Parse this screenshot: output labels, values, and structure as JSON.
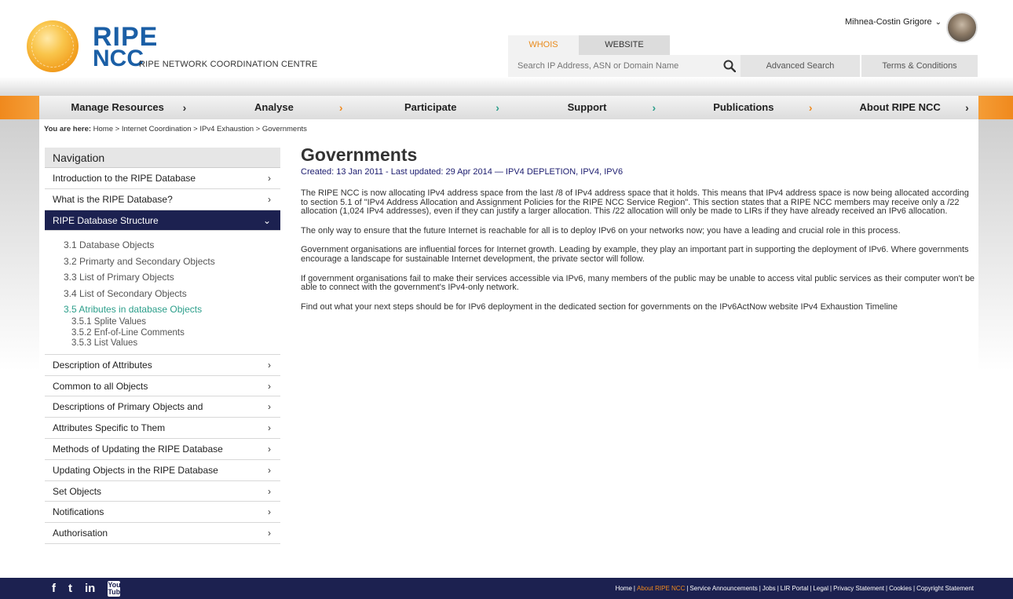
{
  "header": {
    "logo_ripe": "RIPE",
    "logo_ncc": "NCC",
    "logo_sub": "RIPE NETWORK COORDINATION CENTRE",
    "user_name": "Mihnea-Costin Grigore",
    "tabs": [
      {
        "label": "WHOIS"
      },
      {
        "label": "WEBSITE"
      }
    ],
    "search_placeholder": "Search IP Address, ASN or Domain Name",
    "advanced_search": "Advanced Search",
    "terms": "Terms & Conditions"
  },
  "nav": {
    "items": [
      {
        "label": "Manage Resources",
        "chevron_color": "#333333"
      },
      {
        "label": "Analyse",
        "chevron_color": "#f0891d"
      },
      {
        "label": "Participate",
        "chevron_color": "#2b9e8a"
      },
      {
        "label": "Support",
        "chevron_color": "#2b9e8a"
      },
      {
        "label": "Publications",
        "chevron_color": "#f0891d"
      },
      {
        "label": "About RIPE NCC",
        "chevron_color": "#333333"
      }
    ]
  },
  "breadcrumb": {
    "prefix": "You are here:",
    "path": "Home > Internet Coordination > IPv4 Exhaustion >",
    "current": "Governments"
  },
  "sidebar": {
    "title": "Navigation",
    "top_items": [
      {
        "label": "Introduction to the RIPE Database"
      },
      {
        "label": "What is the RIPE Database?"
      }
    ],
    "active_item": {
      "label": "RIPE Database Structure"
    },
    "sub_items": [
      {
        "label": "3.1 Database Objects"
      },
      {
        "label": "3.2 Primarty and Secondary Objects"
      },
      {
        "label": "3.3 List of Primary Objects"
      },
      {
        "label": "3.4 List of Secondary Objects"
      },
      {
        "label": "3.5 Atributes in database Objects"
      }
    ],
    "subsub_items": [
      {
        "label": "3.5.1 Splite Values"
      },
      {
        "label": "3.5.2 Enf-of-Line Comments"
      },
      {
        "label": "3.5.3 List Values"
      }
    ],
    "bottom_items": [
      {
        "label": "Description of Attributes"
      },
      {
        "label": "Common to all Objects"
      },
      {
        "label": "Descriptions of Primary Objects and"
      },
      {
        "label": "Attributes Specific to Them"
      },
      {
        "label": "Methods of Updating the RIPE Database"
      },
      {
        "label": "Updating Objects in the RIPE Database"
      },
      {
        "label": "Set Objects"
      },
      {
        "label": "Notifications"
      },
      {
        "label": "Authorisation"
      }
    ]
  },
  "content": {
    "title": "Governments",
    "meta": "Created: 13 Jan 2011 - Last updated: 29 Apr 2014 — IPV4 DEPLETION, IPV4, IPV6",
    "paragraphs": [
      "The RIPE NCC is now allocating IPv4 address space from the last /8 of IPv4 address space that it holds. This means that IPv4 address space is now being allocated according to section 5.1 of \"IPv4 Address Allocation and Assignment Policies for the RIPE NCC Service Region\". This section states that a RIPE NCC members may receive only a /22 allocation (1,024 IPv4 addresses), even if they can justify a larger allocation. This /22 allocation will only be made to LIRs if they have already received an IPv6 allocation.",
      "The only way to ensure that the future Internet is reachable for all is to deploy IPv6 on your networks now; you have a leading and crucial role in this process.",
      "Government organisations are influential forces for Internet growth. Leading by example, they play an important part in supporting the deployment of IPv6. Where governments encourage a landscape for sustainable Internet development, the private sector will follow.",
      "If government organisations fail to make their services accessible via IPv6, many members of the public may be unable to access vital public services as their computer won't be able to connect with the government's IPv4-only network.",
      "Find out what your next steps should be for IPv6 deployment in the dedicated section for governments on the IPv6ActNow website IPv4 Exhaustion Timeline"
    ]
  },
  "footer": {
    "social": [
      {
        "label": "f",
        "icon": "facebook-icon"
      },
      {
        "label": "t",
        "icon": "twitter-icon"
      },
      {
        "label": "in",
        "icon": "linkedin-icon"
      },
      {
        "label": "You Tube",
        "icon": "youtube-icon"
      }
    ],
    "links": [
      {
        "label": "Home",
        "highlight": false
      },
      {
        "label": "About RIPE NCC",
        "highlight": true
      },
      {
        "label": "Service Announcements",
        "highlight": false
      },
      {
        "label": "Jobs",
        "highlight": false
      },
      {
        "label": "LIR Portal",
        "highlight": false
      },
      {
        "label": "Legal",
        "highlight": false
      },
      {
        "label": "Privacy Statement",
        "highlight": false
      },
      {
        "label": "Cookies",
        "highlight": false
      },
      {
        "label": "Copyright Statement",
        "highlight": false
      }
    ]
  }
}
